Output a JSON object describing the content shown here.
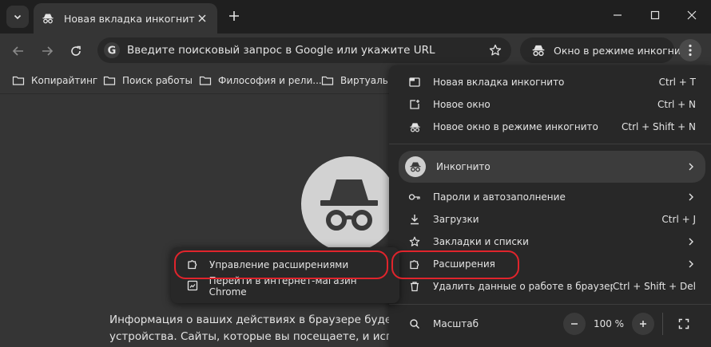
{
  "tab": {
    "title": "Новая вкладка инкогнито"
  },
  "omnibox": {
    "placeholder": "Введите поисковый запрос в Google или укажите URL"
  },
  "incognito_chip": {
    "label": "Окно в режиме инкогнито"
  },
  "bookmarks": [
    {
      "label": "Копирайтинг"
    },
    {
      "label": "Поиск работы"
    },
    {
      "label": "Философия и рели..."
    },
    {
      "label": "Виртуаль"
    }
  ],
  "page": {
    "line1": "Информация о ваших действиях в браузере будет нед",
    "line2": "устройства. Сайты, которые вы посещаете, и использу"
  },
  "menu": {
    "items": [
      {
        "label": "Новая вкладка инкогнито",
        "shortcut": "Ctrl + T"
      },
      {
        "label": "Новое окно",
        "shortcut": "Ctrl + N"
      },
      {
        "label": "Новое окно в режиме инкогнито",
        "shortcut": "Ctrl + Shift + N"
      },
      {
        "label": "Инкогнито"
      },
      {
        "label": "Пароли и автозаполнение"
      },
      {
        "label": "Загрузки",
        "shortcut": "Ctrl + J"
      },
      {
        "label": "Закладки и списки"
      },
      {
        "label": "Расширения"
      },
      {
        "label": "Удалить данные о работе в браузере...",
        "shortcut": "Ctrl + Shift + Del"
      },
      {
        "label": "Масштаб"
      }
    ],
    "zoom": {
      "value": "100 %"
    }
  },
  "submenu": {
    "items": [
      {
        "label": "Управление расширениями"
      },
      {
        "label": "Перейти в интернет-магазин Chrome"
      }
    ]
  },
  "colors": {
    "highlight": "#e0242c",
    "menu_bg": "#282828",
    "frame_bg": "#1f1f1f",
    "page_bg": "#353535"
  }
}
